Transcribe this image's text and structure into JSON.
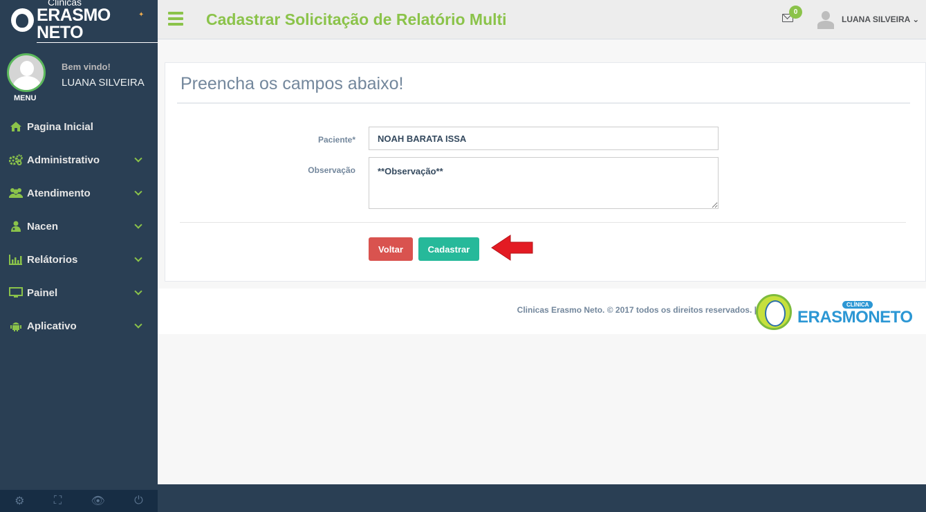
{
  "brand": {
    "small": "Clinicas",
    "big": "ERASMO NETO"
  },
  "profile": {
    "welcome": "Bem vindo!",
    "name": "LUANA SILVEIRA",
    "menu_label": "MENU"
  },
  "nav": [
    {
      "label": "Pagina Inicial",
      "icon": "home-icon",
      "expandable": false
    },
    {
      "label": "Administrativo",
      "icon": "gears-icon",
      "expandable": true
    },
    {
      "label": "Atendimento",
      "icon": "users-icon",
      "expandable": true
    },
    {
      "label": "Nacen",
      "icon": "user-md-icon",
      "expandable": true
    },
    {
      "label": "Relátorios",
      "icon": "bar-chart-icon",
      "expandable": true
    },
    {
      "label": "Painel",
      "icon": "monitor-icon",
      "expandable": true
    },
    {
      "label": "Aplicativo",
      "icon": "android-icon",
      "expandable": true
    }
  ],
  "sidebar_footer": [
    "settings-icon",
    "fullscreen-icon",
    "eye-slash-icon",
    "power-icon"
  ],
  "topbar": {
    "title": "Cadastrar Solicitação de Relatório Multi",
    "mail_count": "0",
    "user": "LUANA SILVEIRA"
  },
  "form": {
    "heading": "Preencha os campos abaixo!",
    "paciente_label": "Paciente*",
    "paciente_value": "NOAH BARATA ISSA",
    "observacao_label": "Observação",
    "observacao_value": "**Observação**",
    "voltar_label": "Voltar",
    "cadastrar_label": "Cadastrar"
  },
  "footer": {
    "text": "Clinicas Erasmo Neto. © 2017 todos os direitos reservados. |",
    "logo_badge": "CLÍNICA",
    "logo_name": "ERASMONETO"
  },
  "colors": {
    "sidebar": "#2a3f54",
    "accent_green": "#8bc34a",
    "btn_danger": "#d9534f",
    "btn_success": "#26b99a",
    "arrow_red": "#e31b23"
  }
}
